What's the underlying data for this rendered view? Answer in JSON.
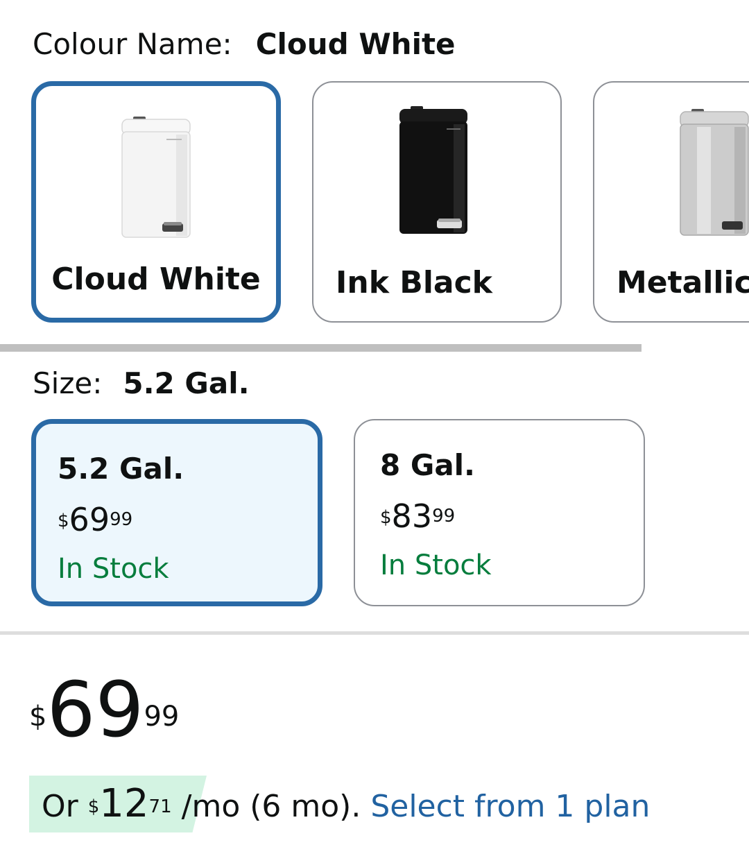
{
  "colour": {
    "label": "Colour Name:",
    "selected": "Cloud White",
    "options": [
      {
        "name": "Cloud White",
        "color": "#f4f4f4"
      },
      {
        "name": "Ink Black",
        "color": "#111111"
      },
      {
        "name": "Metallic",
        "color": "#c9c9c9"
      }
    ]
  },
  "size": {
    "label": "Size:",
    "selected": "5.2 Gal.",
    "options": [
      {
        "name": "5.2 Gal.",
        "currency": "$",
        "whole": "69",
        "fraction": "99",
        "stock": "In Stock"
      },
      {
        "name": "8 Gal.",
        "currency": "$",
        "whole": "83",
        "fraction": "99",
        "stock": "In Stock"
      }
    ]
  },
  "price": {
    "currency": "$",
    "whole": "69",
    "fraction": "99"
  },
  "installment": {
    "prefix": "Or",
    "currency": "$",
    "whole": "12",
    "fraction": "71",
    "suffix": " /mo (6 mo).",
    "link": "Select from 1 plan"
  },
  "colors": {
    "accent": "#2a6aa6",
    "stock": "#067d3d",
    "link": "#2162a1",
    "badge": "#d3f3e2"
  }
}
